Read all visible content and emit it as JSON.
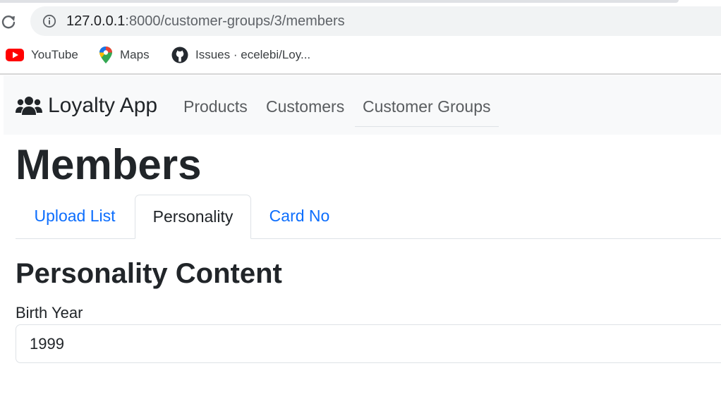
{
  "browser": {
    "url_host": "127.0.0.1",
    "url_rest": ":8000/customer-groups/3/members",
    "bookmarks": [
      {
        "label": "YouTube",
        "icon": "youtube-icon"
      },
      {
        "label": "Maps",
        "icon": "google-maps-icon"
      },
      {
        "label": "Issues · ecelebi/Loy...",
        "icon": "github-icon"
      }
    ]
  },
  "navbar": {
    "brand": "Loyalty App",
    "brand_icon": "users-icon",
    "links": [
      "Products",
      "Customers",
      "Customer Groups"
    ],
    "active_link": "Customer Groups"
  },
  "page": {
    "title": "Members",
    "tabs": [
      "Upload List",
      "Personality",
      "Card No"
    ],
    "active_tab": "Personality",
    "section_title": "Personality Content",
    "birth_year": {
      "label": "Birth Year",
      "value": "1999"
    }
  },
  "colors": {
    "link": "#0d6efd",
    "navbar_bg": "#f8f9fa",
    "text": "#212529"
  }
}
